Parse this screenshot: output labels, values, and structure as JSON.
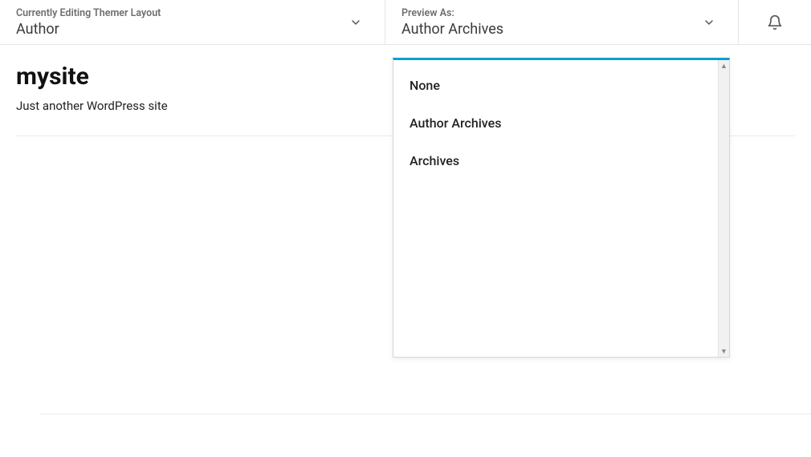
{
  "header": {
    "left": {
      "label": "Currently Editing Themer Layout",
      "value": "Author"
    },
    "right": {
      "label": "Preview As:",
      "value": "Author Archives"
    }
  },
  "site": {
    "title": "mysite",
    "tagline": "Just another WordPress site"
  },
  "dropdown": {
    "options": [
      "None",
      "Author Archives",
      "Archives"
    ]
  }
}
